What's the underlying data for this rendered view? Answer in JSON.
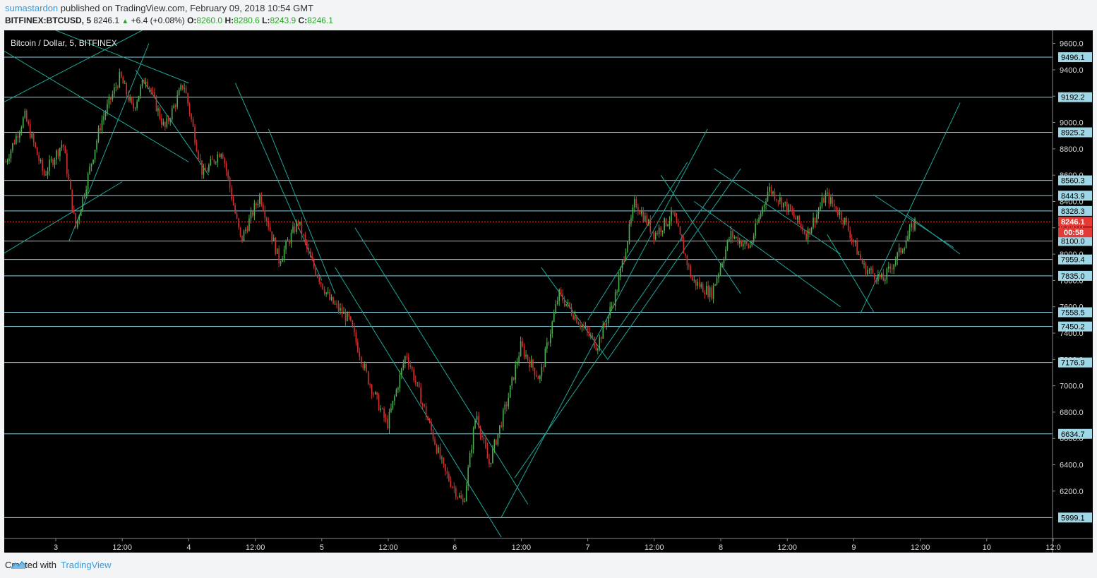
{
  "header": {
    "author": "sumastardon",
    "published": "published on TradingView.com, February 09, 2018 10:54 GMT",
    "symbol": "BITFINEX:BTCUSD, 5",
    "last": "8246.1",
    "change": "+6.4 (+0.08%)",
    "o_label": "O:",
    "o_value": "8260.0",
    "h_label": "H:",
    "h_value": "8280.6",
    "l_label": "L:",
    "l_value": "8243.9",
    "c_label": "C:",
    "c_value": "8246.1"
  },
  "footer": {
    "created": "Created with",
    "brand": "TradingView"
  },
  "colors": {
    "background": "#000000",
    "up": "#4caf50",
    "down": "#d32f2f",
    "hline": "#8fd0df",
    "trend": "#1fa89a",
    "label_bg": "#9fd7e6",
    "price_tag": "#e53935"
  },
  "chart_data": {
    "type": "candlestick",
    "title": "Bitcoin / Dollar, 5, BITFINEX",
    "x_ticks": [
      "3",
      "12:00",
      "4",
      "12:00",
      "5",
      "12:00",
      "6",
      "12:00",
      "7",
      "12:00",
      "8",
      "12:00",
      "9",
      "12:00",
      "10",
      "12:0"
    ],
    "y_ticks": [
      9600.0,
      9400.0,
      9200.0,
      9000.0,
      8800.0,
      8600.0,
      8400.0,
      8200.0,
      8000.0,
      7800.0,
      7600.0,
      7400.0,
      7200.0,
      7000.0,
      6800.0,
      6600.0,
      6400.0,
      6200.0
    ],
    "ylim": [
      5840,
      9700
    ],
    "horizontal_levels": [
      9496.1,
      9192.2,
      8925.2,
      8560.3,
      8443.9,
      8328.3,
      8100.0,
      7959.4,
      7835.0,
      7558.5,
      7450.2,
      7176.9,
      6634.7,
      5999.1
    ],
    "current_price": 8246.1,
    "countdown": "00:58",
    "close_path": [
      [
        2.0,
        8700
      ],
      [
        2.3,
        9050
      ],
      [
        2.6,
        8600
      ],
      [
        2.9,
        8850
      ],
      [
        3.1,
        8200
      ],
      [
        3.3,
        8600
      ],
      [
        3.5,
        9000
      ],
      [
        3.8,
        9350
      ],
      [
        4.0,
        9100
      ],
      [
        4.2,
        9350
      ],
      [
        4.5,
        8950
      ],
      [
        4.8,
        9300
      ],
      [
        5.1,
        8600
      ],
      [
        5.4,
        8800
      ],
      [
        5.7,
        8100
      ],
      [
        6.0,
        8450
      ],
      [
        6.3,
        7950
      ],
      [
        6.6,
        8250
      ],
      [
        6.8,
        7950
      ],
      [
        7.1,
        7650
      ],
      [
        7.4,
        7500
      ],
      [
        7.7,
        7050
      ],
      [
        8.0,
        6700
      ],
      [
        8.3,
        7250
      ],
      [
        8.6,
        6800
      ],
      [
        8.9,
        6350
      ],
      [
        9.2,
        6100
      ],
      [
        9.4,
        6800
      ],
      [
        9.6,
        6400
      ],
      [
        9.9,
        6900
      ],
      [
        10.1,
        7300
      ],
      [
        10.4,
        7050
      ],
      [
        10.7,
        7700
      ],
      [
        11.0,
        7500
      ],
      [
        11.3,
        7300
      ],
      [
        11.6,
        7700
      ],
      [
        11.9,
        8400
      ],
      [
        12.2,
        8150
      ],
      [
        12.5,
        8300
      ],
      [
        12.8,
        7800
      ],
      [
        13.1,
        7700
      ],
      [
        13.4,
        8150
      ],
      [
        13.7,
        8050
      ],
      [
        14.0,
        8500
      ],
      [
        14.3,
        8350
      ],
      [
        14.6,
        8150
      ],
      [
        14.9,
        8450
      ],
      [
        15.2,
        8250
      ],
      [
        15.5,
        7900
      ],
      [
        15.8,
        7800
      ],
      [
        16.1,
        8050
      ],
      [
        16.3,
        8246
      ]
    ]
  }
}
